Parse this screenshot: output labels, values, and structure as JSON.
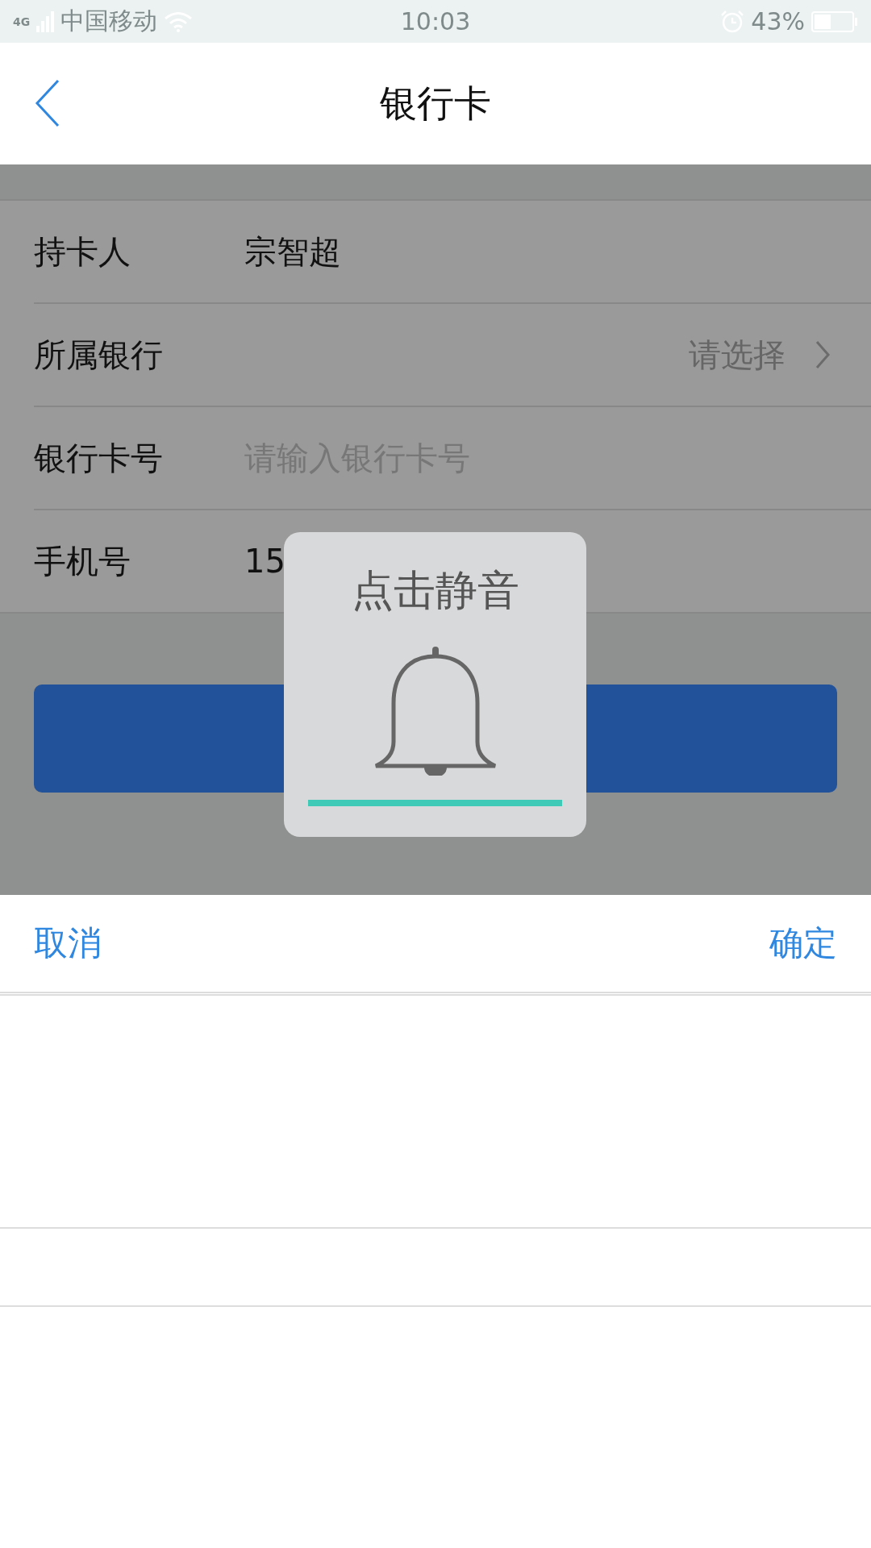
{
  "status_bar": {
    "carrier": "中国移动",
    "network": "4G",
    "time": "10:03",
    "battery": "43%"
  },
  "nav": {
    "title": "银行卡"
  },
  "form": [
    {
      "kind": "text",
      "label": "持卡人",
      "value": "宗智超"
    },
    {
      "kind": "select",
      "label": "所属银行",
      "placeholder": "请选择"
    },
    {
      "kind": "input",
      "label": "银行卡号",
      "placeholder": "请输入银行卡号"
    },
    {
      "kind": "text",
      "label": "手机号",
      "value": "15"
    }
  ],
  "toast": {
    "title": "点击静音",
    "level": 1
  },
  "picker": {
    "cancel": "取消",
    "confirm": "确定"
  }
}
